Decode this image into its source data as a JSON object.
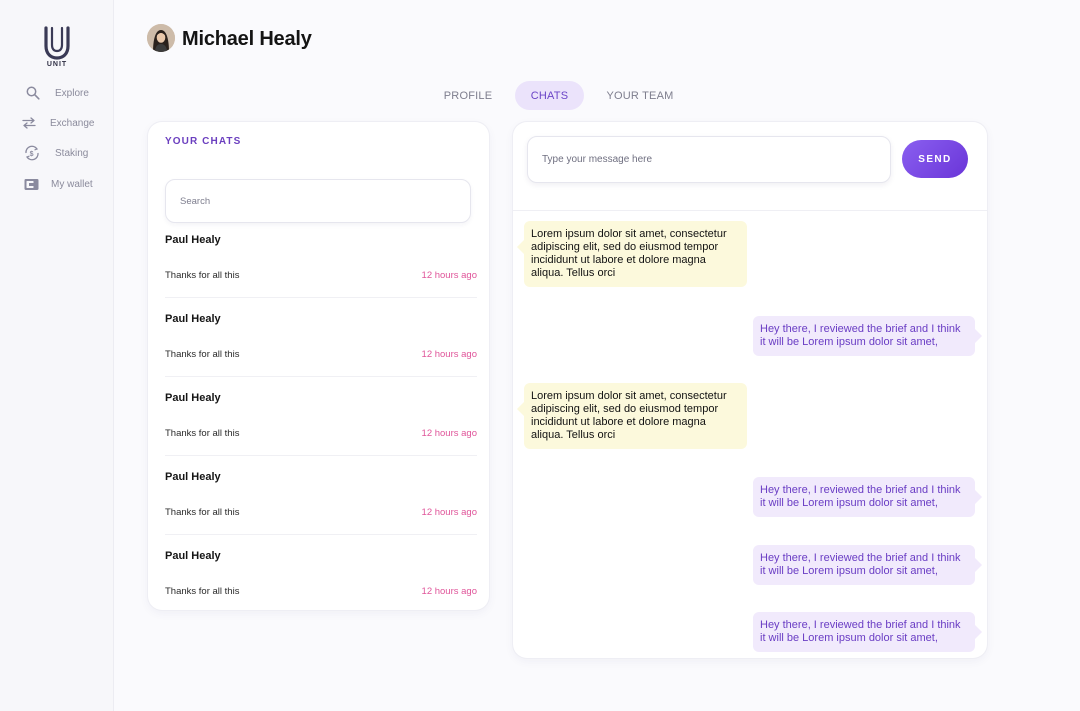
{
  "app": {
    "logo_text": "UNIT"
  },
  "sidebar": {
    "items": [
      {
        "label": "Explore",
        "icon": "search-icon"
      },
      {
        "label": "Exchange",
        "icon": "exchange-arrows-icon"
      },
      {
        "label": "Staking",
        "icon": "staking-coin-icon"
      },
      {
        "label": "My wallet",
        "icon": "wallet-icon"
      }
    ]
  },
  "header": {
    "title": "Michael Healy",
    "avatar_icon": "user-avatar"
  },
  "tabs": [
    {
      "label": "PROFILE",
      "active": false
    },
    {
      "label": "CHATS",
      "active": true
    },
    {
      "label": "YOUR TEAM",
      "active": false
    }
  ],
  "chat_list": {
    "heading": "YOUR CHATS",
    "search_placeholder": "Search",
    "items": [
      {
        "name": "Paul Healy",
        "preview": "Thanks for all this",
        "time": "12 hours ago"
      },
      {
        "name": "Paul Healy",
        "preview": "Thanks for all this",
        "time": "12 hours ago"
      },
      {
        "name": "Paul Healy",
        "preview": "Thanks for all this",
        "time": "12 hours ago"
      },
      {
        "name": "Paul Healy",
        "preview": "Thanks for all this",
        "time": "12 hours ago"
      },
      {
        "name": "Paul Healy",
        "preview": "Thanks for all this",
        "time": "12 hours ago"
      }
    ]
  },
  "conversation": {
    "input_placeholder": "Type your message here",
    "send_label": "SEND",
    "messages": [
      {
        "direction": "incoming",
        "text": "Lorem ipsum dolor sit amet, consectetur adipiscing elit, sed do eiusmod tempor incididunt ut labore et dolore magna aliqua. Tellus orci"
      },
      {
        "direction": "outgoing",
        "text": "Hey there, I reviewed the brief and I think it will be Lorem ipsum dolor sit amet,"
      },
      {
        "direction": "incoming",
        "text": "Lorem ipsum dolor sit amet, consectetur adipiscing elit, sed do eiusmod tempor incididunt ut labore et dolore magna aliqua. Tellus orci"
      },
      {
        "direction": "outgoing",
        "text": "Hey there, I reviewed the brief and I think it will be Lorem ipsum dolor sit amet,"
      },
      {
        "direction": "outgoing",
        "text": "Hey there, I reviewed the brief and I think it will be Lorem ipsum dolor sit amet,"
      },
      {
        "direction": "outgoing",
        "text": "Hey there, I reviewed the brief and I think it will be Lorem ipsum dolor sit amet,"
      }
    ]
  },
  "colors": {
    "accent": "#6a44c7",
    "time_pink": "#e0559a",
    "incoming_bubble": "#fcf9dc",
    "outgoing_bubble": "#f1eafc"
  }
}
